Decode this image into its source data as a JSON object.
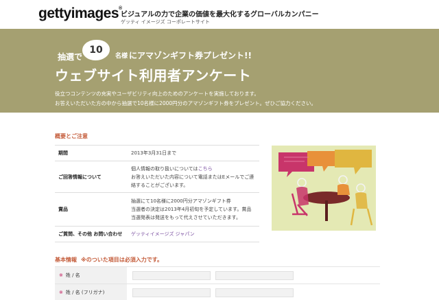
{
  "header": {
    "logo": "gettyimages",
    "logo_mark": "®",
    "tagline": "ビジュアルの力で企業の価値を最大化するグローバルカンパニー",
    "tagline_sub": "ゲッティ イメージズ コーポレートサイト"
  },
  "banner": {
    "promo_lead": "抽選で",
    "promo_number": "10",
    "promo_suffix": "名様",
    "promo_tail": "にアマゾンギフト券プレゼント!!",
    "title": "ウェブサイト利用者アンケート",
    "desc_line1": "役立つコンテンツの充実やユーザビリティ向上のためのアンケートを実施しております。",
    "desc_line2": "お答えいただいた方の中から抽選で10名様に2000円分のアマゾンギフト券をプレゼント。ぜひご協力ください。"
  },
  "overview": {
    "title": "概要とご注意",
    "rows": [
      {
        "key": "期間",
        "lines": [
          "2013年3月31日まで"
        ]
      },
      {
        "key": "ご回答情報について",
        "lines": [
          "個人情報の取り扱いについては",
          "お答えいただいた内容について電話またはEメールでご連",
          "絡することがございます。"
        ],
        "link": "こちら"
      },
      {
        "key": "賞品",
        "lines": [
          "抽選にて10名様に2000円分アマゾンギフト券",
          "当選者の決定は2013年4月初旬を予定しています。賞品",
          "当選発表は発送をもって代えさせていただきます。"
        ]
      },
      {
        "key": "ご質問、その他 お問い合わせ",
        "lines": [],
        "link": "ゲッティイメージズ ジャパン"
      }
    ]
  },
  "basic": {
    "title": "基本情報",
    "note": "※のついた項目は必須入力です。",
    "required_mark": "※",
    "fields": [
      {
        "label": "姓 / 名"
      },
      {
        "label": "姓 / 名 (フリガナ)"
      }
    ]
  },
  "illustration": {
    "icon": "meeting-speech-bubbles-illustration",
    "colors": {
      "background": "#e4e9b4",
      "bubble_magenta": "#c8356a",
      "bubble_orange": "#e8913a",
      "bubble_yellow": "#e0b640",
      "table": "#7a2a2a"
    }
  },
  "colors": {
    "banner": "#a5a071",
    "accent": "#c45c3a",
    "link": "#7a4fa0",
    "required": "#c2185b"
  }
}
